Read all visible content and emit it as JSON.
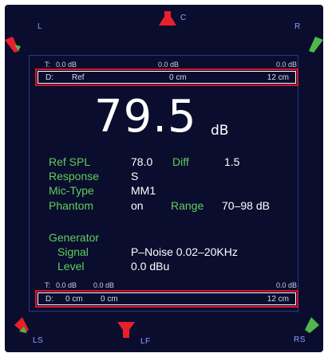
{
  "colors": {
    "background": "#0b0d2e",
    "label_green": "#5fcf5a",
    "value_white": "#ffffff",
    "highlight_red": "#d9142a",
    "speaker_red": "#e8202c",
    "speaker_green": "#4fb84a"
  },
  "speakers": {
    "l": {
      "label": "L",
      "icon": "speaker-l-icon"
    },
    "c": {
      "label": "C",
      "icon": "speaker-c-icon"
    },
    "r": {
      "label": "R",
      "icon": "speaker-r-icon"
    },
    "ls": {
      "label": "LS",
      "icon": "speaker-ls-icon"
    },
    "lf": {
      "label": "LF",
      "icon": "speaker-lf-icon"
    },
    "rs": {
      "label": "RS",
      "icon": "speaker-rs-icon"
    }
  },
  "top_t": {
    "label": "T:",
    "v1": "0.0 dB",
    "v2": "0.0 dB",
    "v3": "0.0 dB"
  },
  "top_d": {
    "label": "D:",
    "v1": "Ref",
    "v2": "0 cm",
    "v3": "12 cm"
  },
  "reading": {
    "value": "79.5",
    "unit": "dB"
  },
  "params": {
    "ref_spl_label": "Ref SPL",
    "ref_spl_value": "78.0",
    "diff_label": "Diff",
    "diff_value": "1.5",
    "response_label": "Response",
    "response_value": "S",
    "mic_type_label": "Mic-Type",
    "mic_type_value": "MM1",
    "phantom_label": "Phantom",
    "phantom_value": "on",
    "range_label": "Range",
    "range_value": "70–98 dB"
  },
  "generator": {
    "title": "Generator",
    "signal_label": "Signal",
    "signal_value": "P–Noise 0.02–20KHz",
    "level_label": "Level",
    "level_value": "0.0 dBu"
  },
  "bottom_t": {
    "label": "T:",
    "v1": "0.0 dB",
    "v2": "0.0 dB",
    "v3": "0.0 dB"
  },
  "bottom_d": {
    "label": "D:",
    "v1": "0 cm",
    "v2": "0 cm",
    "v3": "12 cm"
  }
}
